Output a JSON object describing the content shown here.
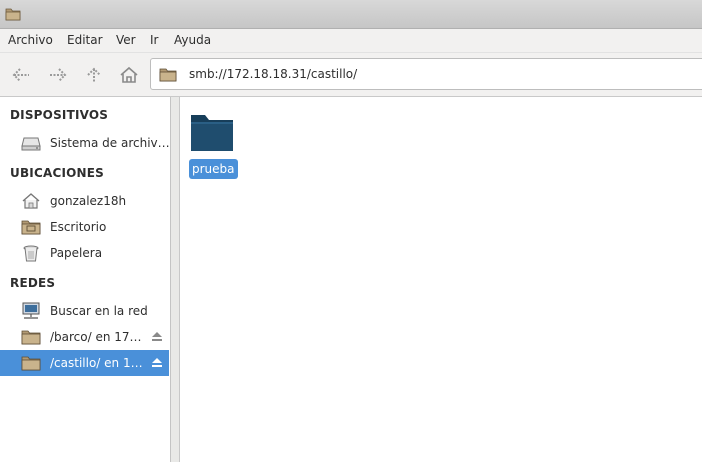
{
  "menu": [
    "Archivo",
    "Editar",
    "Ver",
    "Ir",
    "Ayuda"
  ],
  "toolbar": {
    "icons": [
      "back-arrow-icon",
      "forward-arrow-icon",
      "up-arrow-icon",
      "home-icon"
    ]
  },
  "location": {
    "value": "smb://172.18.18.31/castillo/"
  },
  "sidebar": {
    "devices_title": "DISPOSITIVOS",
    "devices": [
      {
        "label": "Sistema de archiv…",
        "icon": "drive-icon"
      }
    ],
    "places_title": "UBICACIONES",
    "places": [
      {
        "label": "gonzalez18h",
        "icon": "home-icon"
      },
      {
        "label": "Escritorio",
        "icon": "desktop-folder-icon"
      },
      {
        "label": "Papelera",
        "icon": "trash-icon"
      }
    ],
    "network_title": "REDES",
    "network": [
      {
        "label": "Buscar en la red",
        "icon": "network-icon"
      },
      {
        "label": "/barco/ en 17…",
        "icon": "folder-icon"
      },
      {
        "label": "/castillo/ en 1…",
        "icon": "folder-icon",
        "selected": true
      }
    ]
  },
  "files": [
    {
      "name": "prueba",
      "icon": "folder-icon",
      "selected": true
    }
  ],
  "colors": {
    "selection": "#4a90d9",
    "folder": "#1f4d6e",
    "sidebar_folder": "#b19a74"
  }
}
